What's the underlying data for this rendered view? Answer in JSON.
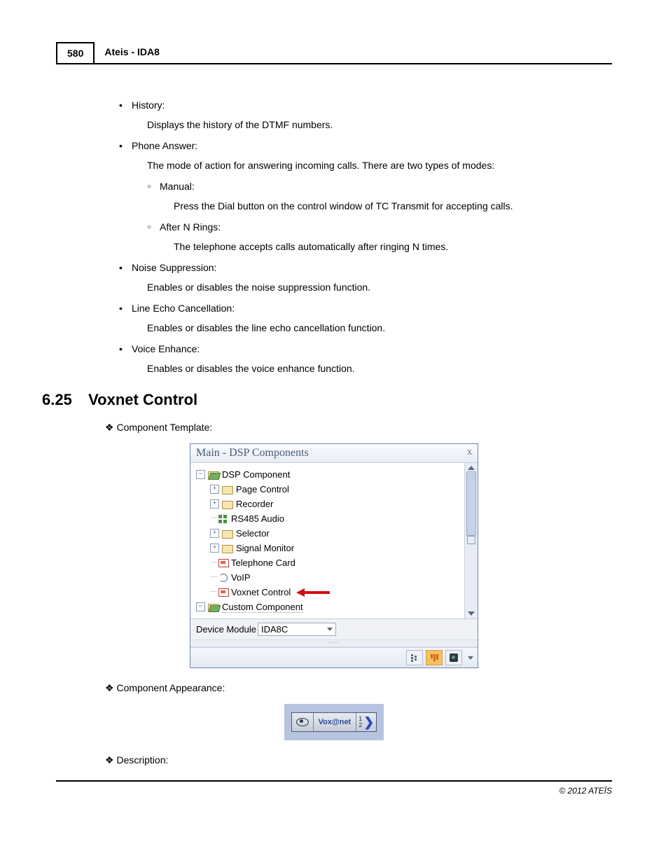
{
  "header": {
    "page_number": "580",
    "title": "Ateis - IDA8"
  },
  "bullets": {
    "history": {
      "label": "History:",
      "desc": "Displays the history of the DTMF numbers."
    },
    "phone_answer": {
      "label": "Phone Answer:",
      "desc": "The mode of action for answering incoming calls. There are two types of modes:",
      "manual": {
        "label": "Manual:",
        "desc": "Press the Dial button on the control window of TC Transmit for accepting calls."
      },
      "after_n": {
        "label": "After N Rings:",
        "desc": "The telephone accepts calls automatically after ringing N times."
      }
    },
    "noise": {
      "label": "Noise Suppression:",
      "desc": "Enables or disables the noise suppression function."
    },
    "echo": {
      "label": "Line Echo Cancellation:",
      "desc": "Enables or disables the line echo cancellation function."
    },
    "voice": {
      "label": "Voice Enhance:",
      "desc": "Enables or disables the voice enhance function."
    }
  },
  "section": {
    "num": "6.25",
    "title": "Voxnet Control"
  },
  "diamonds": {
    "template": "Component Template:",
    "appearance": "Component Appearance:",
    "description": "Description:"
  },
  "panel": {
    "title": "Main - DSP Components",
    "close": "x",
    "tree": {
      "root": "DSP Component",
      "items": {
        "page_control": "Page Control",
        "recorder": "Recorder",
        "rs485": "RS485 Audio",
        "selector": "Selector",
        "signal_monitor": "Signal Monitor",
        "telephone_card": "Telephone Card",
        "voip": "VoIP",
        "voxnet": "Voxnet Control"
      },
      "custom": "Custom Component"
    },
    "device_module_label": "Device Module",
    "device_module_value": "IDA8C"
  },
  "component": {
    "label": "Vox@net",
    "n1": "1",
    "n2": "2"
  },
  "footer": "© 2012 ATEÏS"
}
